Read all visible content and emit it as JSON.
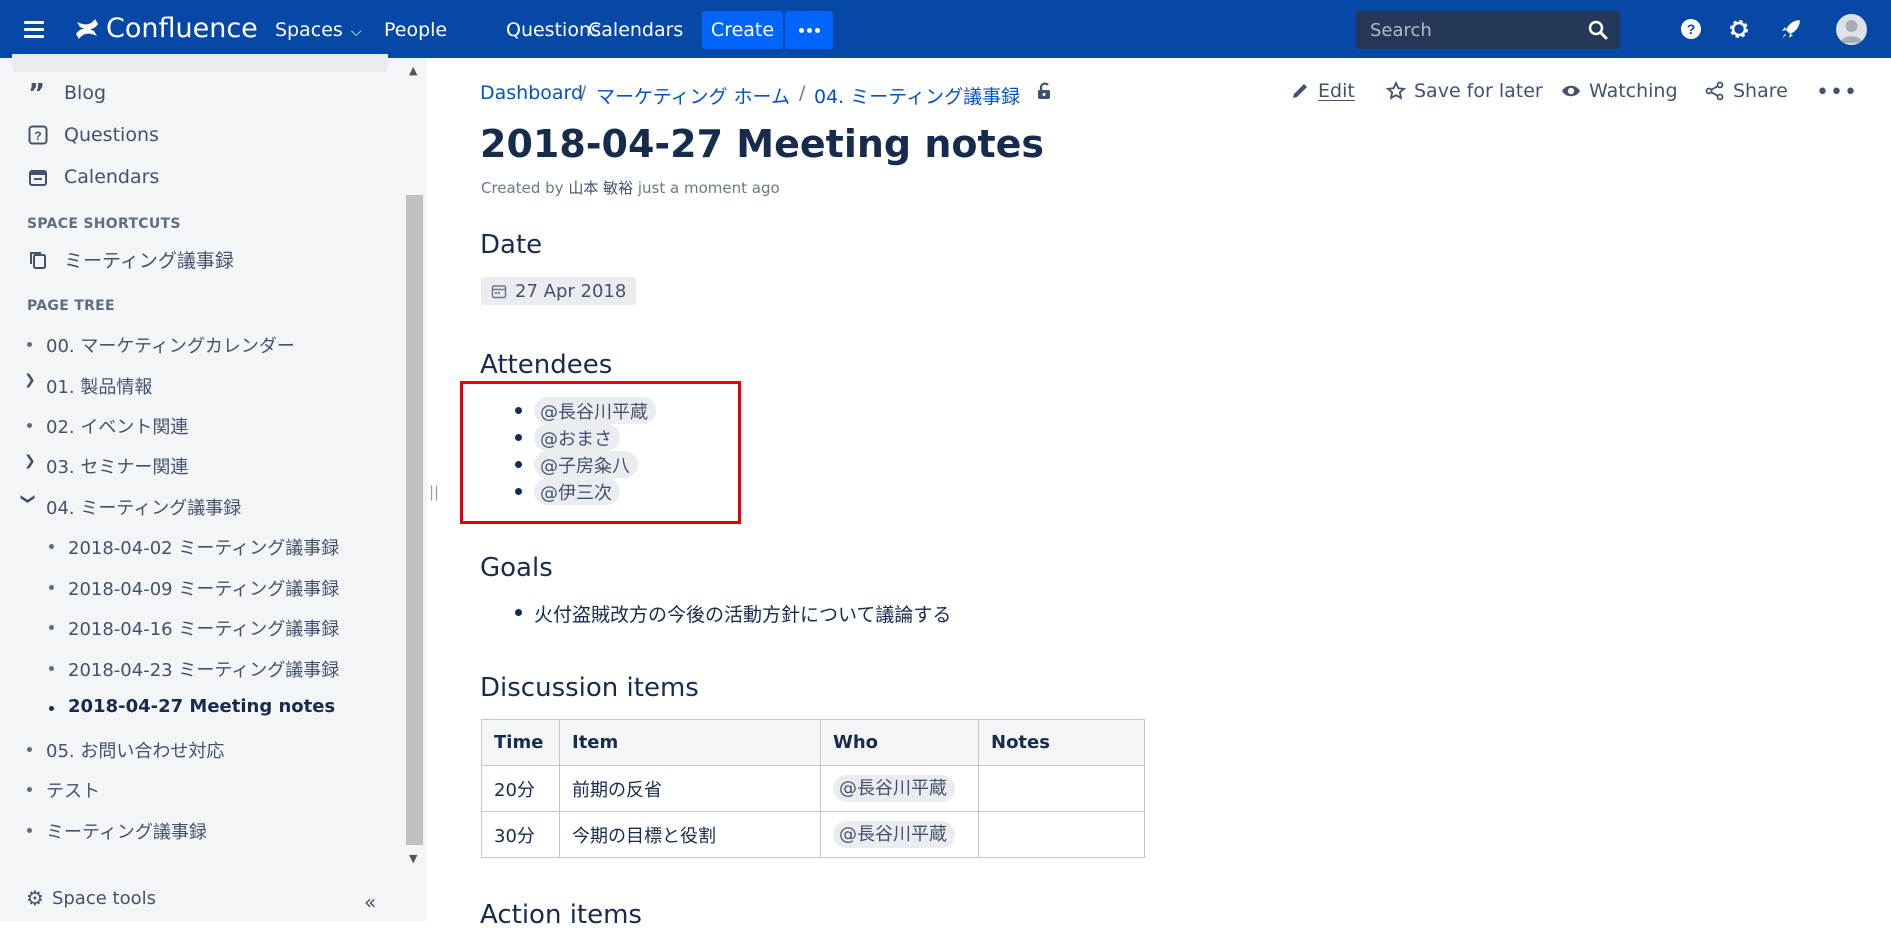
{
  "topbar": {
    "app_name": "Confluence",
    "nav": [
      "Spaces",
      "People",
      "Questions",
      "Calendars"
    ],
    "create_label": "Create",
    "search_placeholder": "Search"
  },
  "sidebar": {
    "links": [
      "Blog",
      "Questions",
      "Calendars"
    ],
    "shortcuts_heading": "SPACE SHORTCUTS",
    "shortcut": "ミーティング議事録",
    "tree_heading": "PAGE TREE",
    "tree": [
      "00. マーケティングカレンダー",
      "01. 製品情報",
      "02. イベント関連",
      "03. セミナー関連",
      "04. ミーティング議事録",
      "2018-04-02 ミーティング議事録",
      "2018-04-09 ミーティング議事録",
      "2018-04-16 ミーティング議事録",
      "2018-04-23 ミーティング議事録",
      "2018-04-27 Meeting notes",
      "05. お問い合わせ対応",
      "テスト",
      "ミーティング議事録"
    ],
    "space_tools": "Space tools"
  },
  "breadcrumb": [
    "Dashboard",
    "マーケティング ホーム",
    "04. ミーティング議事録"
  ],
  "actions": {
    "edit": "Edit",
    "save": "Save for later",
    "watching": "Watching",
    "share": "Share"
  },
  "page": {
    "title": "2018-04-27 Meeting notes",
    "byline_prefix": "Created by",
    "author": "山本 敏裕",
    "byline_suffix": "just a moment ago",
    "date_heading": "Date",
    "date_value": "27 Apr 2018",
    "attendees_heading": "Attendees",
    "attendees": [
      "@長谷川平蔵",
      "@おまさ",
      "@子房粂八",
      "@伊三次"
    ],
    "goals_heading": "Goals",
    "goals": [
      "火付盗賊改方の今後の活動方針について議論する"
    ],
    "discussion_heading": "Discussion items",
    "table_headers": [
      "Time",
      "Item",
      "Who",
      "Notes"
    ],
    "table_rows": [
      {
        "time": "20分",
        "item": "前期の反省",
        "who": "@長谷川平蔵",
        "notes": ""
      },
      {
        "time": "30分",
        "item": "今期の目標と役割",
        "who": "@長谷川平蔵",
        "notes": ""
      }
    ],
    "action_items_heading": "Action items"
  }
}
